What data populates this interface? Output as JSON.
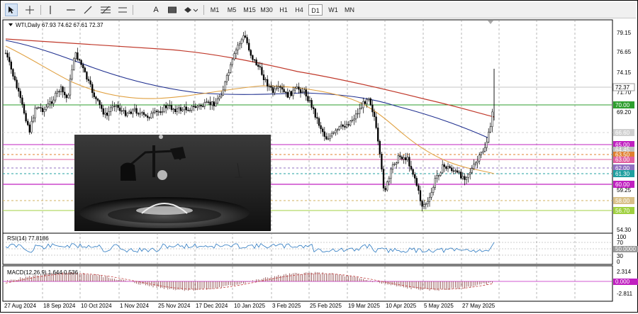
{
  "toolbar": {
    "tools": [
      "cursor-icon",
      "crosshair-icon",
      "vertical-line-icon",
      "horizontal-line-icon",
      "trendline-icon",
      "fibonacci-icon",
      "text-icon",
      "label-icon",
      "rectangle-icon",
      "shapes-icon"
    ],
    "text_tool_label": "A",
    "timeframes": [
      "M1",
      "M5",
      "M15",
      "M30",
      "H1",
      "H4",
      "D1",
      "W1",
      "MN"
    ],
    "active_timeframe": "D1"
  },
  "chart": {
    "header": "WTI,Daily  67.93 74.62 67.61 72.37",
    "price_axis": [
      "79.15",
      "76.65",
      "74.15",
      "71.70",
      "69.20",
      "59.25",
      "54.30"
    ],
    "current_price": "72.37",
    "level_tags": [
      "70.00",
      "66.60",
      "65.00",
      "64.45",
      "63.50",
      "63.00",
      "62.00",
      "61.30",
      "60.00",
      "58.00",
      "56.70"
    ],
    "date_axis": [
      "27 Aug 2024",
      "18 Sep 2024",
      "10 Oct 2024",
      "1 Nov 2024",
      "25 Nov 2024",
      "17 Dec 2024",
      "10 Jan 2025",
      "3 Feb 2025",
      "25 Feb 2025",
      "19 Mar 2025",
      "10 Apr 2025",
      "5 May 2025",
      "27 May 2025"
    ],
    "colors": {
      "ma_red": "#c0392b",
      "ma_blue": "#1f2f8f",
      "ma_orange": "#e0a040",
      "candles": "#000000",
      "level_green": "#2e9e2e",
      "level_magenta": "#c020c0",
      "level_pink": "#e06090",
      "level_orange": "#e08030",
      "level_teal": "#20a0a0",
      "level_lime": "#a0d040",
      "level_gray": "#b0b0b0",
      "rsi_line": "#2a78c0",
      "macd": "#c04040"
    }
  },
  "rsi": {
    "label": "RSI(14) 77.8186",
    "axis": [
      "100",
      "70",
      "30",
      "0"
    ],
    "level_tag": "50.0000"
  },
  "macd": {
    "label": "MACD(12,26,9) 1.644 0.536",
    "axis": [
      "2.314",
      "-2.811"
    ],
    "level_tag": "0.000"
  }
}
